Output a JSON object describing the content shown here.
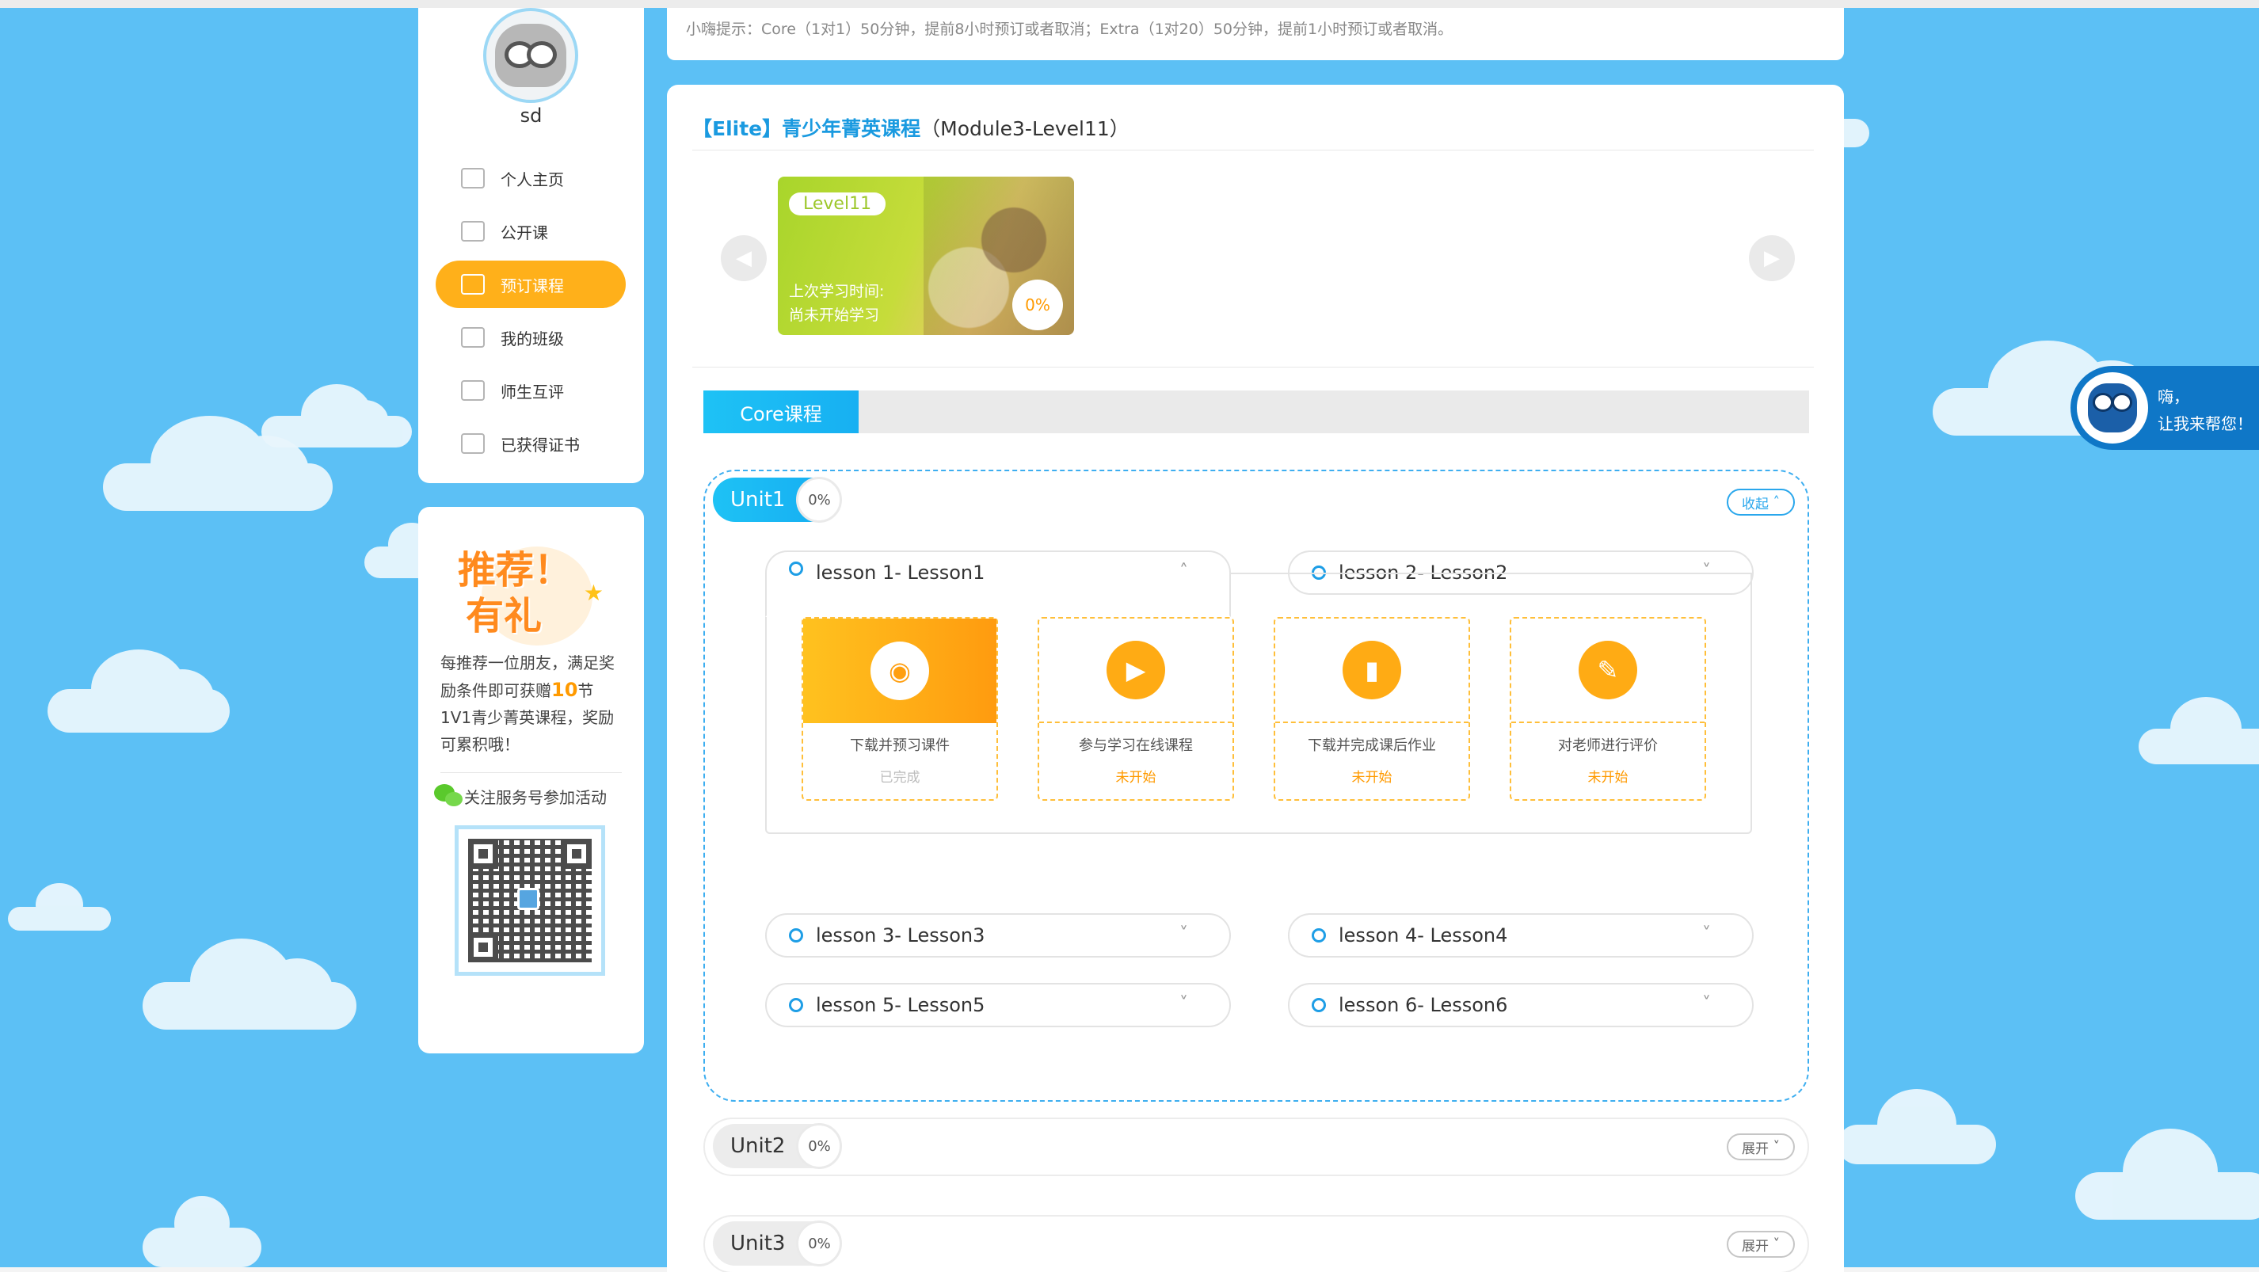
{
  "notice": "小嗨提示：Core（1对1）50分钟，提前8小时预订或者取消；Extra（1对20）50分钟，提前1小时预订或者取消。",
  "profile": {
    "username": "sd"
  },
  "sidebar": {
    "items": [
      {
        "label": "个人主页",
        "icon": "home-icon"
      },
      {
        "label": "公开课",
        "icon": "tv-icon"
      },
      {
        "label": "预订课程",
        "icon": "book-icon",
        "active": true
      },
      {
        "label": "我的班级",
        "icon": "group-icon"
      },
      {
        "label": "师生互评",
        "icon": "comment-icon"
      },
      {
        "label": "已获得证书",
        "icon": "certificate-icon"
      }
    ]
  },
  "promo": {
    "badge_line1": "推荐！",
    "badge_line2": "有礼",
    "text_before": "每推荐一位朋友，满足奖励条件即可获赠",
    "highlight": "10",
    "text_after": "节1V1青少菁英课程，奖励可累积哦！",
    "wechat_label": "关注服务号参加活动"
  },
  "course": {
    "brand": "【Elite】青少年菁英课程",
    "module": "（Module3-Level11）",
    "level_card": {
      "tag": "Level11",
      "last_study_label": "上次学习时间:",
      "last_study_value": "尚未开始学习",
      "progress": "0%"
    },
    "tabs": [
      {
        "label": "Core课程",
        "active": true
      }
    ]
  },
  "units": [
    {
      "name": "Unit1",
      "progress": "0%",
      "toggle": "收起",
      "expanded": true,
      "lessons": [
        {
          "label": "lesson 1- Lesson1",
          "open": true
        },
        {
          "label": "lesson 2- Lesson2"
        },
        {
          "label": "lesson 3- Lesson3"
        },
        {
          "label": "lesson 4- Lesson4"
        },
        {
          "label": "lesson 5- Lesson5"
        },
        {
          "label": "lesson 6- Lesson6"
        }
      ],
      "steps": [
        {
          "label": "下载并预习课件",
          "status": "已完成",
          "icon": "eye-icon"
        },
        {
          "label": "参与学习在线课程",
          "status": "未开始",
          "icon": "play-icon"
        },
        {
          "label": "下载并完成课后作业",
          "status": "未开始",
          "icon": "notebook-icon"
        },
        {
          "label": "对老师进行评价",
          "status": "未开始",
          "icon": "edit-icon"
        }
      ]
    },
    {
      "name": "Unit2",
      "progress": "0%",
      "toggle": "展开"
    },
    {
      "name": "Unit3",
      "progress": "0%",
      "toggle": "展开"
    }
  ],
  "chat": {
    "line1": "嗨，",
    "line2": "让我来帮您！"
  },
  "colors": {
    "primary": "#17b0f2",
    "accent": "#ffb01a",
    "sky": "#5cc0f5"
  }
}
